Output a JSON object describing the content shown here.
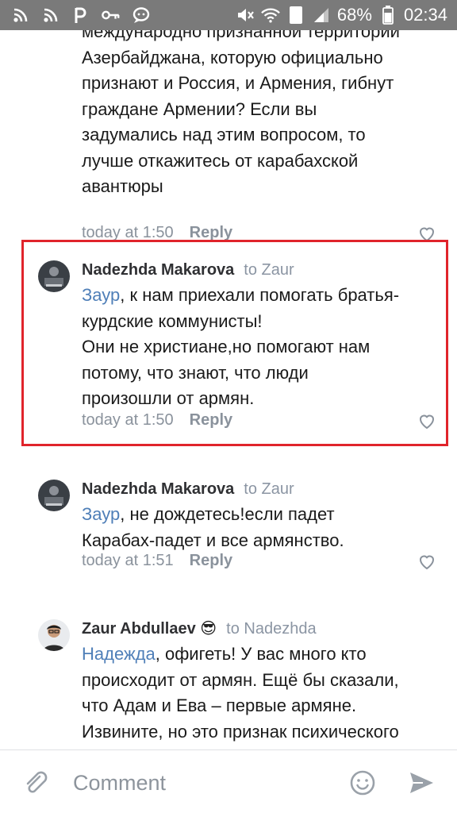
{
  "status_bar": {
    "battery": "68%",
    "time": "02:34",
    "sim": "1"
  },
  "comments": [
    {
      "text_lines": [
        "международно признанной территории",
        "Азербайджана, которую официально",
        "признают и Россия, и Армения, гибнут",
        "граждане Армении? Если вы",
        "задумались над этим вопросом, то",
        "лучше откажитесь от карабахской",
        "авантюры"
      ],
      "time": "today at 1:50",
      "reply": "Reply"
    },
    {
      "author": "Nadezhda Makarova",
      "to": "to Zaur",
      "mention": "Заур",
      "text": ", к нам приехали  помогать братья-\nкурдские коммунисты!\nОни не христиане,но помогают нам\nпотому, что знают, что люди\nпроизошли от армян.",
      "time": "today at 1:50",
      "reply": "Reply"
    },
    {
      "author": "Nadezhda Makarova",
      "to": "to Zaur",
      "mention": "Заур",
      "text": ", не дождетесь!если падет\nКарабах-падет и все армянство.",
      "time": "today at 1:51",
      "reply": "Reply"
    },
    {
      "author": "Zaur Abdullaev",
      "emoji": "😎",
      "to": "to Nadezhda",
      "mention": "Надежда",
      "text": ", офигеть! У вас много кто\nпроисходит от армян. Ещё бы сказали,\nчто Адам и Ева – первые армяне.\nИзвините, но это признак психического\nрасстройства"
    }
  ],
  "composer": {
    "placeholder": "Comment"
  },
  "colors": {
    "highlight": "#e0242b",
    "mention": "#4f7fb8",
    "meta": "#8a929c"
  },
  "icons": [
    "attach-icon",
    "emoji-icon",
    "send-icon",
    "heart-icon"
  ]
}
